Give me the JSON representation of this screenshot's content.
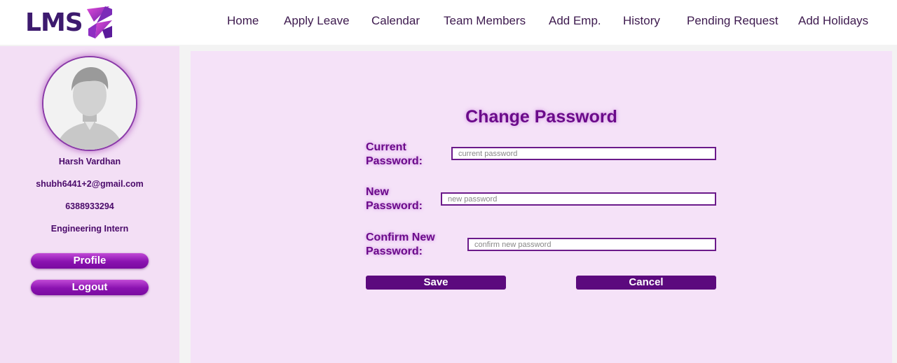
{
  "header": {
    "logo_text": "LMS",
    "nav": [
      "Home",
      "Apply Leave",
      "Calendar",
      "Team Members",
      "Add Emp.",
      "History",
      "Pending Request",
      "Add Holidays"
    ]
  },
  "sidebar": {
    "name": "Harsh Vardhan",
    "email": "shubh6441+2@gmail.com",
    "phone": "6388933294",
    "role": "Engineering Intern",
    "profile_button": "Profile",
    "logout_button": "Logout"
  },
  "form": {
    "title": "Change Password",
    "current_label_line1": "Current",
    "current_label_line2": "Password:",
    "current_placeholder": "current password",
    "new_label_line1": "New",
    "new_label_line2": "Password:",
    "new_placeholder": "new password",
    "confirm_label_line1": "Confirm New",
    "confirm_label_line2": "Password:",
    "confirm_placeholder": "confirm new password",
    "save_button": "Save",
    "cancel_button": "Cancel"
  },
  "colors": {
    "brand": "#3d1a6e",
    "accent": "#6b0a8a",
    "button": "#5c0a7e"
  }
}
